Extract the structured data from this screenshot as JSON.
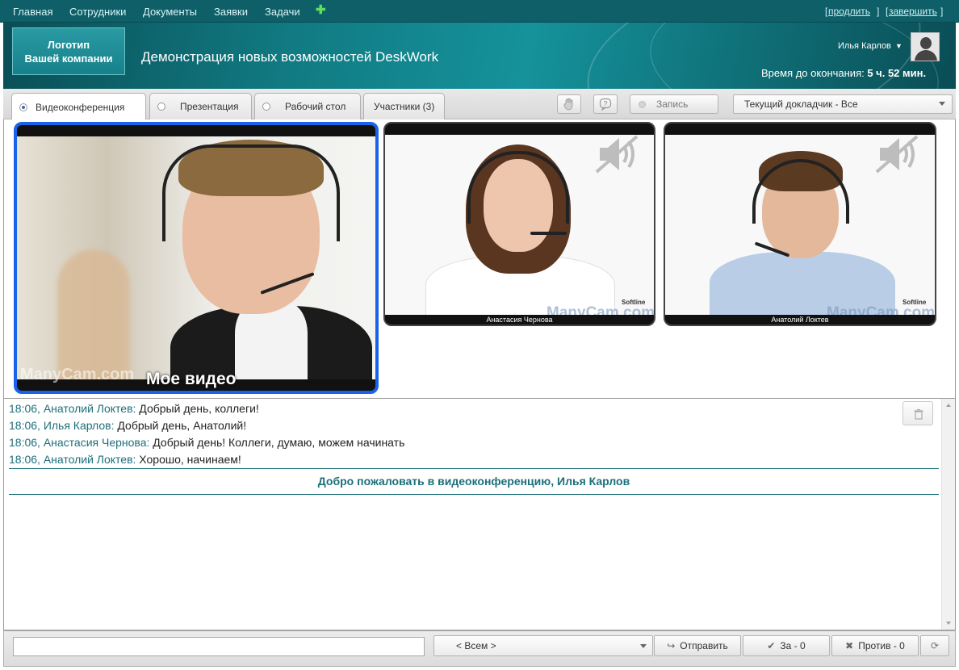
{
  "nav": {
    "items": [
      "Главная",
      "Сотрудники",
      "Документы",
      "Заявки",
      "Задачи"
    ],
    "add_icon": "plus-icon",
    "extend_label": "продлить",
    "finish_label": "завершить"
  },
  "banner": {
    "logo_line1": "Логотип",
    "logo_line2": "Вашей компании",
    "title": "Демонстрация новых возможностей DeskWork",
    "user_name": "Илья Карлов",
    "time_label": "Время до окончания:",
    "time_value": "5 ч. 52 мин."
  },
  "tabs": [
    {
      "label": "Видеоконференция",
      "active": true,
      "radio": true
    },
    {
      "label": "Презентация",
      "active": false,
      "radio": true
    },
    {
      "label": "Рабочий стол",
      "active": false,
      "radio": true
    },
    {
      "label": "Участники (3)",
      "active": false,
      "radio": false
    }
  ],
  "toolbar": {
    "hand_icon": "raise-hand-icon",
    "help_icon": "help-icon",
    "record_label": "Запись",
    "speaker_select": "Текущий докладчик - Все"
  },
  "videos": {
    "self_label": "Мое видео",
    "participant1": "Анастасия Чернова",
    "participant2": "Анатолий Локтев",
    "watermark": "ManyCam.com",
    "softline": "Softline",
    "mute_icon": "muted-speaker-icon"
  },
  "chat": {
    "messages": [
      {
        "meta": "18:06, Анатолий Локтев:",
        "text": " Добрый день, коллеги!"
      },
      {
        "meta": "18:06, Илья Карлов:",
        "text": " Добрый день, Анатолий!"
      },
      {
        "meta": "18:06, Анастасия Чернова:",
        "text": " Добрый день! Коллеги, думаю, можем начинать"
      },
      {
        "meta": "18:06, Анатолий Локтев:",
        "text": " Хорошо, начинаем!"
      }
    ],
    "welcome": "Добро пожаловать в видеоконференцию, Илья Карлов",
    "clear_icon": "trash-icon"
  },
  "bottom": {
    "input_value": "",
    "recipient": "< Всем >",
    "send_label": "Отправить",
    "for_label": "За - 0",
    "against_label": "Против - 0",
    "refresh_icon": "refresh-icon"
  },
  "colors": {
    "nav_bg": "#0e5f68",
    "accent": "#1d6f7a",
    "self_border": "#1a63e8"
  }
}
